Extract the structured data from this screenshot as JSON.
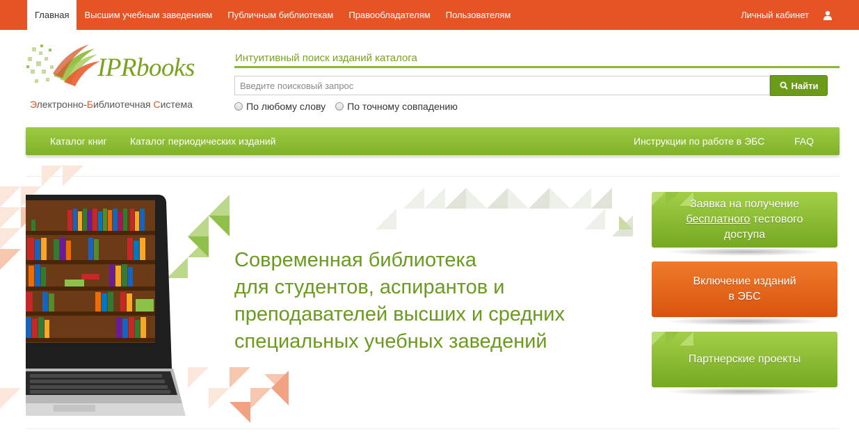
{
  "topbar": {
    "nav": [
      {
        "label": "Главная",
        "active": true
      },
      {
        "label": "Высшим учебным заведениям",
        "active": false
      },
      {
        "label": "Публичным библиотекам",
        "active": false
      },
      {
        "label": "Правообладателям",
        "active": false
      },
      {
        "label": "Пользователям",
        "active": false
      }
    ],
    "account_label": "Личный кабинет",
    "account_icon": "user-icon",
    "color": "#e65325"
  },
  "logo": {
    "brand_ipr": "IPR",
    "brand_books": "books",
    "subtitle_parts": [
      "Э",
      "лектронно-",
      "Б",
      "иблиотечная ",
      "С",
      "истема"
    ]
  },
  "search": {
    "title": "Интуитивный поиск изданий каталога",
    "placeholder": "Введите поисковый запрос",
    "button_label": "Найти",
    "button_icon": "search-icon",
    "options": [
      "По любому слову",
      "По точному совпадению"
    ]
  },
  "greennav": {
    "left": [
      "Каталог книг",
      "Каталог периодических изданий"
    ],
    "right": [
      "Инструкции по работе в ЭБС",
      "FAQ"
    ]
  },
  "hero": {
    "lines": [
      "Современная библиотека",
      "для студентов, аспирантов и",
      "преподавателей высших и средних",
      "специальных учебных заведений"
    ]
  },
  "side_buttons": {
    "trial": {
      "line1": "Заявка на получение",
      "line2_u": "бесплатного",
      "line2_rest": " тестового",
      "line3": "доступа"
    },
    "include": {
      "line1": "Включение изданий",
      "line2": "в ЭБС"
    },
    "partners": {
      "line1": "Партнерские проекты"
    }
  },
  "colors": {
    "brand_orange": "#e65325",
    "brand_green": "#7aa21f"
  }
}
